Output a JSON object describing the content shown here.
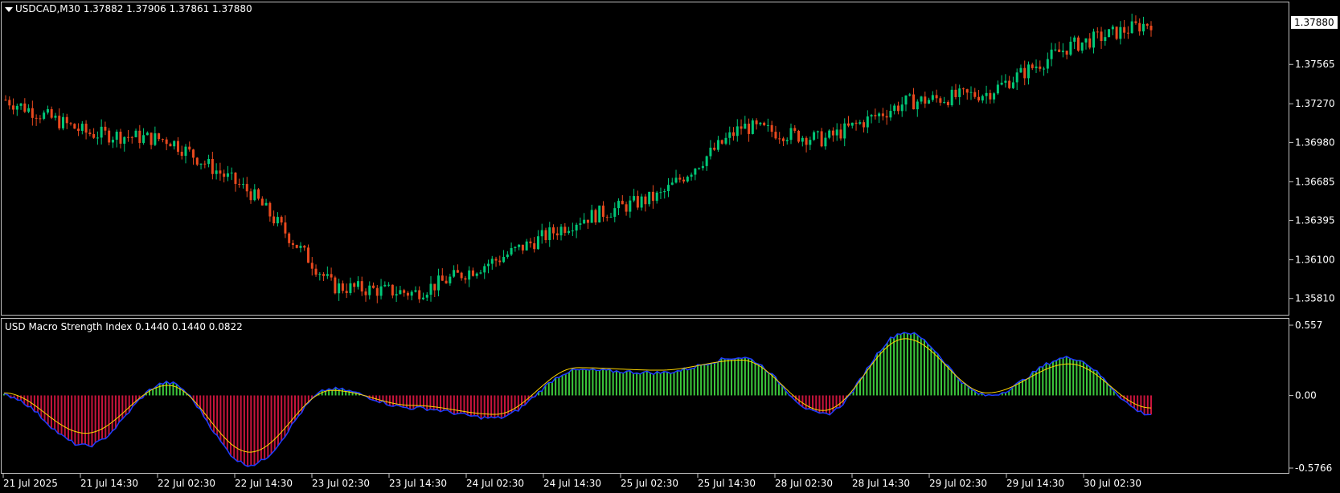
{
  "header": {
    "symbol_line": "USDCAD,M30  1.37882 1.37906 1.37861 1.37880"
  },
  "indicator": {
    "title_line": "USD Macro Strength Index 0.1440 0.1440 0.0822"
  },
  "price_axis": {
    "ticks": [
      "1.37565",
      "1.37270",
      "1.36980",
      "1.36685",
      "1.36395",
      "1.36100",
      "1.35810"
    ],
    "current_price": "1.37880"
  },
  "indicator_axis": {
    "ticks": [
      "0.557",
      "0.00",
      "-0.5766"
    ]
  },
  "time_axis": {
    "labels": [
      "21 Jul 2025",
      "21 Jul 14:30",
      "22 Jul 02:30",
      "22 Jul 14:30",
      "23 Jul 02:30",
      "23 Jul 14:30",
      "24 Jul 02:30",
      "24 Jul 14:30",
      "25 Jul 02:30",
      "25 Jul 14:30",
      "28 Jul 02:30",
      "28 Jul 14:30",
      "29 Jul 02:30",
      "29 Jul 14:30",
      "30 Jul 02:30"
    ]
  },
  "colors": {
    "background": "#000000",
    "bull_candle": "#00c878",
    "bear_candle": "#e8491e",
    "hist_positive": "#3cc83c",
    "hist_negative": "#c8143c",
    "signal_line": "#ffd700",
    "outline": "#1e3cff"
  },
  "chart_data": [
    {
      "type": "line",
      "title": "USDCAD,M30",
      "ylim": [
        1.357,
        1.38
      ],
      "x": [
        "21 Jul 2025",
        "21 Jul 14:30",
        "22 Jul 02:30",
        "22 Jul 14:30",
        "23 Jul 02:30",
        "23 Jul 14:30",
        "24 Jul 02:30",
        "24 Jul 14:30",
        "25 Jul 02:30",
        "25 Jul 14:30",
        "28 Jul 02:30",
        "28 Jul 14:30",
        "29 Jul 02:30",
        "29 Jul 14:30",
        "30 Jul 02:30"
      ],
      "series": [
        {
          "values": [
            1.373,
            1.3705,
            1.37,
            1.366,
            1.359,
            1.3585,
            1.361,
            1.364,
            1.3658,
            1.371,
            1.37,
            1.3728,
            1.3735,
            1.377,
            1.3788
          ]
        }
      ]
    },
    {
      "type": "bar",
      "title": "USD Macro Strength Index",
      "ylim": [
        -0.5766,
        0.557
      ],
      "categories": [
        "21 Jul 2025",
        "21 Jul 14:30",
        "22 Jul 02:30",
        "22 Jul 14:30",
        "23 Jul 02:30",
        "23 Jul 14:30",
        "24 Jul 02:30",
        "24 Jul 14:30",
        "25 Jul 02:30",
        "25 Jul 14:30",
        "28 Jul 02:30",
        "28 Jul 14:30",
        "29 Jul 02:30",
        "29 Jul 14:30",
        "30 Jul 02:30"
      ],
      "values": [
        0.0,
        -0.4,
        0.1,
        -0.55,
        0.05,
        -0.1,
        -0.18,
        0.2,
        0.18,
        0.3,
        -0.15,
        0.5,
        0.0,
        0.3,
        -0.15
      ],
      "series": [
        {
          "values": [
            0.0,
            -0.4,
            0.1,
            -0.55,
            0.05,
            -0.1,
            -0.18,
            0.2,
            0.18,
            0.3,
            -0.15,
            0.5,
            0.0,
            0.3,
            -0.15
          ]
        },
        {
          "values": [
            0.02,
            -0.3,
            0.08,
            -0.45,
            0.04,
            -0.08,
            -0.15,
            0.22,
            0.2,
            0.28,
            -0.12,
            0.45,
            0.02,
            0.25,
            -0.1
          ]
        }
      ]
    }
  ]
}
